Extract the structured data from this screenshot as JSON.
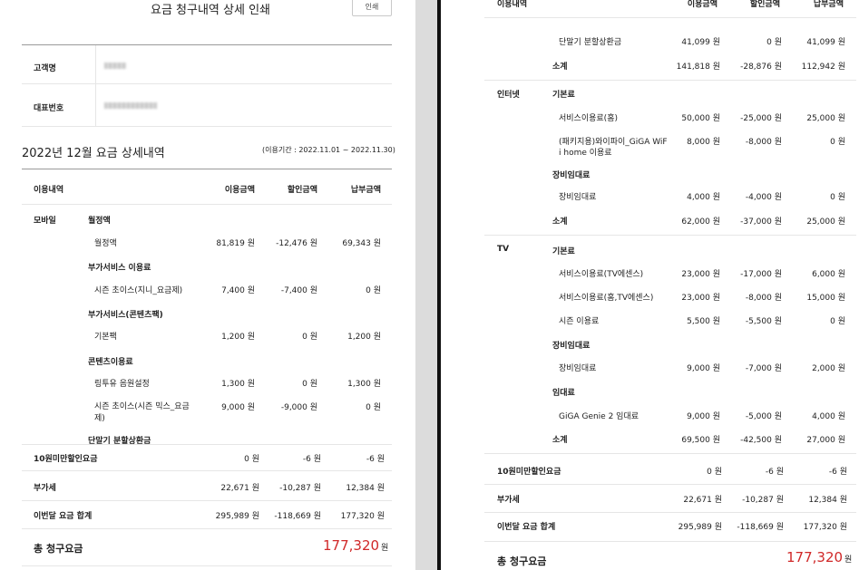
{
  "header": {
    "title": "요금 청구내역 상세 인쇄",
    "print_label": "인쇄"
  },
  "customer": {
    "name_label": "고객명",
    "phone_label": "대표번호"
  },
  "bill": {
    "heading": "2022년 12월 요금 상세내역",
    "period": "(이용기간 : 2022.11.01 ~ 2022.11.30)"
  },
  "columns": [
    "이용내역",
    "이용금액",
    "할인금액",
    "납부금액"
  ],
  "mobile": {
    "label": "모바일",
    "monthly": {
      "title": "월정액",
      "item": {
        "name": "월정액",
        "use": "81,819 원",
        "disc": "-12,476 원",
        "pay": "69,343 원"
      }
    },
    "addon": {
      "title": "부가서비스 이용료",
      "item": {
        "name": "시즌 초이스(지니_요금제)",
        "use": "7,400 원",
        "disc": "-7,400 원",
        "pay": "0 원"
      }
    },
    "addon_content": {
      "title": "부가서비스(콘텐츠팩)",
      "item": {
        "name": "기본팩",
        "use": "1,200 원",
        "disc": "0 원",
        "pay": "1,200 원"
      }
    },
    "content": {
      "title": "콘텐츠이용료",
      "item1": {
        "name": "링투유 음원설정",
        "use": "1,300 원",
        "disc": "0 원",
        "pay": "1,300 원"
      },
      "item2": {
        "name1": "시즌 초이스(시즌 믹스_요금",
        "name2": "제)",
        "use": "9,000 원",
        "disc": "-9,000 원",
        "pay": "0 원"
      }
    },
    "device_installment": {
      "title": "단말기 분할상환금",
      "item": {
        "name": "단말기 분할상환금",
        "use": "41,099 원",
        "disc": "0 원",
        "pay": "41,099 원"
      }
    },
    "subtotal": {
      "label": "소계",
      "use": "141,818 원",
      "disc": "-28,876 원",
      "pay": "112,942 원"
    }
  },
  "internet": {
    "label": "인터넷",
    "basic": {
      "title": "기본료",
      "item1": {
        "name": "서비스이용료(홈)",
        "use": "50,000 원",
        "disc": "-25,000 원",
        "pay": "25,000 원"
      },
      "item2": {
        "name1": "(패키지용)와이파이_GiGA WiF",
        "name2": "i home 이용료",
        "use": "8,000 원",
        "disc": "-8,000 원",
        "pay": "0 원"
      }
    },
    "rental": {
      "title": "장비임대료",
      "item": {
        "name": "장비임대료",
        "use": "4,000 원",
        "disc": "-4,000 원",
        "pay": "0 원"
      }
    },
    "subtotal": {
      "label": "소계",
      "use": "62,000 원",
      "disc": "-37,000 원",
      "pay": "25,000 원"
    }
  },
  "tv": {
    "label": "TV",
    "basic": {
      "title": "기본료",
      "item1": {
        "name": "서비스이용료(TV에센스)",
        "use": "23,000 원",
        "disc": "-17,000 원",
        "pay": "6,000 원"
      },
      "item2": {
        "name": "서비스이용료(홈,TV에센스)",
        "use": "23,000 원",
        "disc": "-8,000 원",
        "pay": "15,000 원"
      },
      "item3": {
        "name": "시즌 이용료",
        "use": "5,500 원",
        "disc": "-5,500 원",
        "pay": "0 원"
      }
    },
    "rental": {
      "title": "장비임대료",
      "item": {
        "name": "장비임대료",
        "use": "9,000 원",
        "disc": "-7,000 원",
        "pay": "2,000 원"
      }
    },
    "lease": {
      "title": "임대료",
      "item": {
        "name": "GiGA Genie 2 임대료",
        "use": "9,000 원",
        "disc": "-5,000 원",
        "pay": "4,000 원"
      }
    },
    "subtotal": {
      "label": "소계",
      "use": "69,500 원",
      "disc": "-42,500 원",
      "pay": "27,000 원"
    }
  },
  "summary": {
    "under10": {
      "label": "10원미만할인요금",
      "use": "0 원",
      "disc": "-6 원",
      "pay": "-6 원"
    },
    "vat": {
      "label": "부가세",
      "use": "22,671 원",
      "disc": "-10,287 원",
      "pay": "12,384 원"
    },
    "total": {
      "label": "이번달 요금 합계",
      "use": "295,989 원",
      "disc": "-118,669 원",
      "pay": "177,320 원"
    }
  },
  "grand_total": {
    "label": "총 청구요금",
    "amount": "177,320",
    "unit": "원"
  },
  "colors": {
    "accent": "#d02828",
    "divider": "#dcdcdc"
  }
}
